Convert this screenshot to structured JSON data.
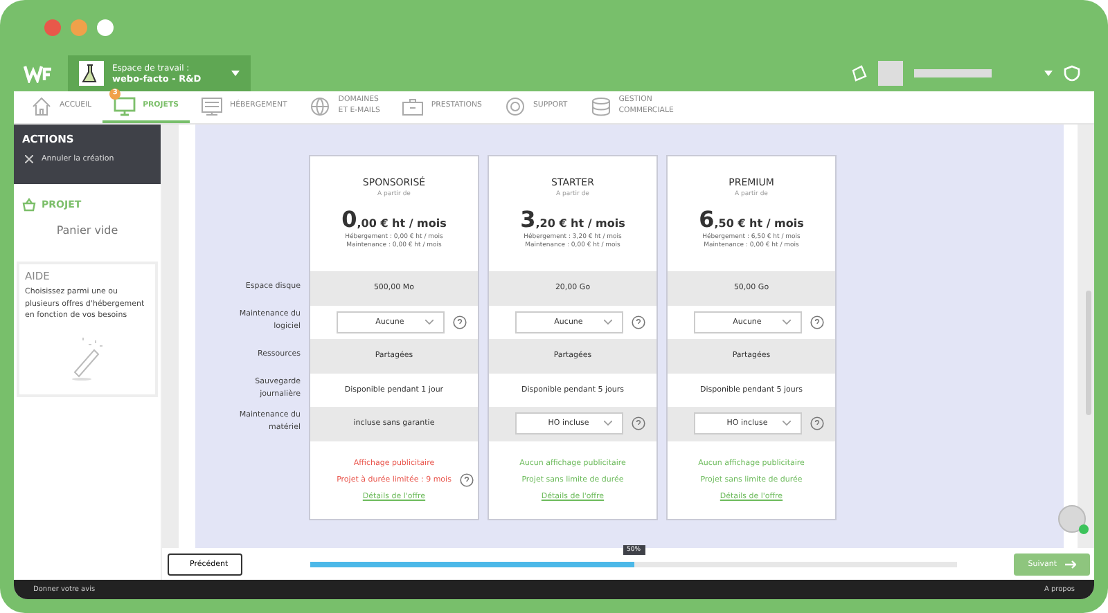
{
  "workspace": {
    "label": "Espace de travail :",
    "name": "webo-facto - R&D"
  },
  "nav": [
    {
      "label": "ACCUEIL",
      "selected": false
    },
    {
      "label": "PROJETS",
      "selected": true,
      "badge": "3"
    },
    {
      "label": "HÉBERGEMENT",
      "selected": false
    },
    {
      "label": "DOMAINES\nET E-MAILS",
      "selected": false
    },
    {
      "label": "PRESTATIONS",
      "selected": false
    },
    {
      "label": "SUPPORT",
      "selected": false
    },
    {
      "label": "GESTION\nCOMMERCIALE",
      "selected": false
    }
  ],
  "sidebar": {
    "actions_title": "ACTIONS",
    "actions": [
      "Annuler la création"
    ],
    "project_title": "PROJET",
    "cart": "Panier vide",
    "help_title": "AIDE",
    "help_text": "Choisissez parmi une ou plusieurs offres d'hébergement en fonction de vos besoins"
  },
  "rows": [
    {
      "label": "Espace disque",
      "shaded": true
    },
    {
      "label": "Maintenance du logiciel",
      "shaded": false
    },
    {
      "label": "Ressources",
      "shaded": true
    },
    {
      "label": "Sauvegarde journalière",
      "shaded": false
    },
    {
      "label": "Maintenance du matériel",
      "shaded": true
    }
  ],
  "plans": [
    {
      "name": "SPONSORISÉ",
      "from": "A partir de",
      "price_int": "0",
      "price_rest": ",00 € ht / mois",
      "hosting": "Hébergement : 0,00 € ht / mois",
      "maintenance": "Maintenance : 0,00 € ht / mois",
      "cells": [
        {
          "kind": "text",
          "text": "500,00 Mo"
        },
        {
          "kind": "select",
          "value": "Aucune"
        },
        {
          "kind": "text",
          "text": "Partagées"
        },
        {
          "kind": "text",
          "text": "Disponible pendant 1 jour"
        },
        {
          "kind": "text",
          "text": "incluse sans garantie"
        }
      ],
      "notes": [
        {
          "kind": "plain",
          "text": "Affichage publicitaire",
          "positive": false
        },
        {
          "kind": "help",
          "text": "Projet à durée limitée : 9 mois",
          "positive": false
        }
      ],
      "link": "Détails de l'offre"
    },
    {
      "name": "STARTER",
      "from": "A partir de",
      "price_int": "3",
      "price_rest": ",20 € ht / mois",
      "hosting": "Hébergement : 3,20 € ht / mois",
      "maintenance": "Maintenance : 0,00 € ht / mois",
      "cells": [
        {
          "kind": "text",
          "text": "20,00 Go"
        },
        {
          "kind": "select",
          "value": "Aucune"
        },
        {
          "kind": "text",
          "text": "Partagées"
        },
        {
          "kind": "text",
          "text": "Disponible pendant 5 jours"
        },
        {
          "kind": "select",
          "value": "HO incluse"
        }
      ],
      "notes": [
        {
          "kind": "plain",
          "text": "Aucun affichage publicitaire",
          "positive": true
        },
        {
          "kind": "plain",
          "text": "Projet sans limite de durée",
          "positive": true
        }
      ],
      "link": "Détails de l'offre"
    },
    {
      "name": "PREMIUM",
      "from": "A partir de",
      "price_int": "6",
      "price_rest": ",50 € ht / mois",
      "hosting": "Hébergement : 6,50 € ht / mois",
      "maintenance": "Maintenance : 0,00 € ht / mois",
      "cells": [
        {
          "kind": "text",
          "text": "50,00 Go"
        },
        {
          "kind": "select",
          "value": "Aucune"
        },
        {
          "kind": "text",
          "text": "Partagées"
        },
        {
          "kind": "text",
          "text": "Disponible pendant 5 jours"
        },
        {
          "kind": "select",
          "value": "HO incluse"
        }
      ],
      "notes": [
        {
          "kind": "plain",
          "text": "Aucun affichage publicitaire",
          "positive": true
        },
        {
          "kind": "plain",
          "text": "Projet sans limite de durée",
          "positive": true
        }
      ],
      "link": "Détails de l'offre"
    }
  ],
  "wizard": {
    "previous": "Précédent",
    "next": "Suivant",
    "level": 0.5,
    "reading": "50%"
  },
  "footer": {
    "left": "Donner votre avis",
    "right": "A propos"
  }
}
